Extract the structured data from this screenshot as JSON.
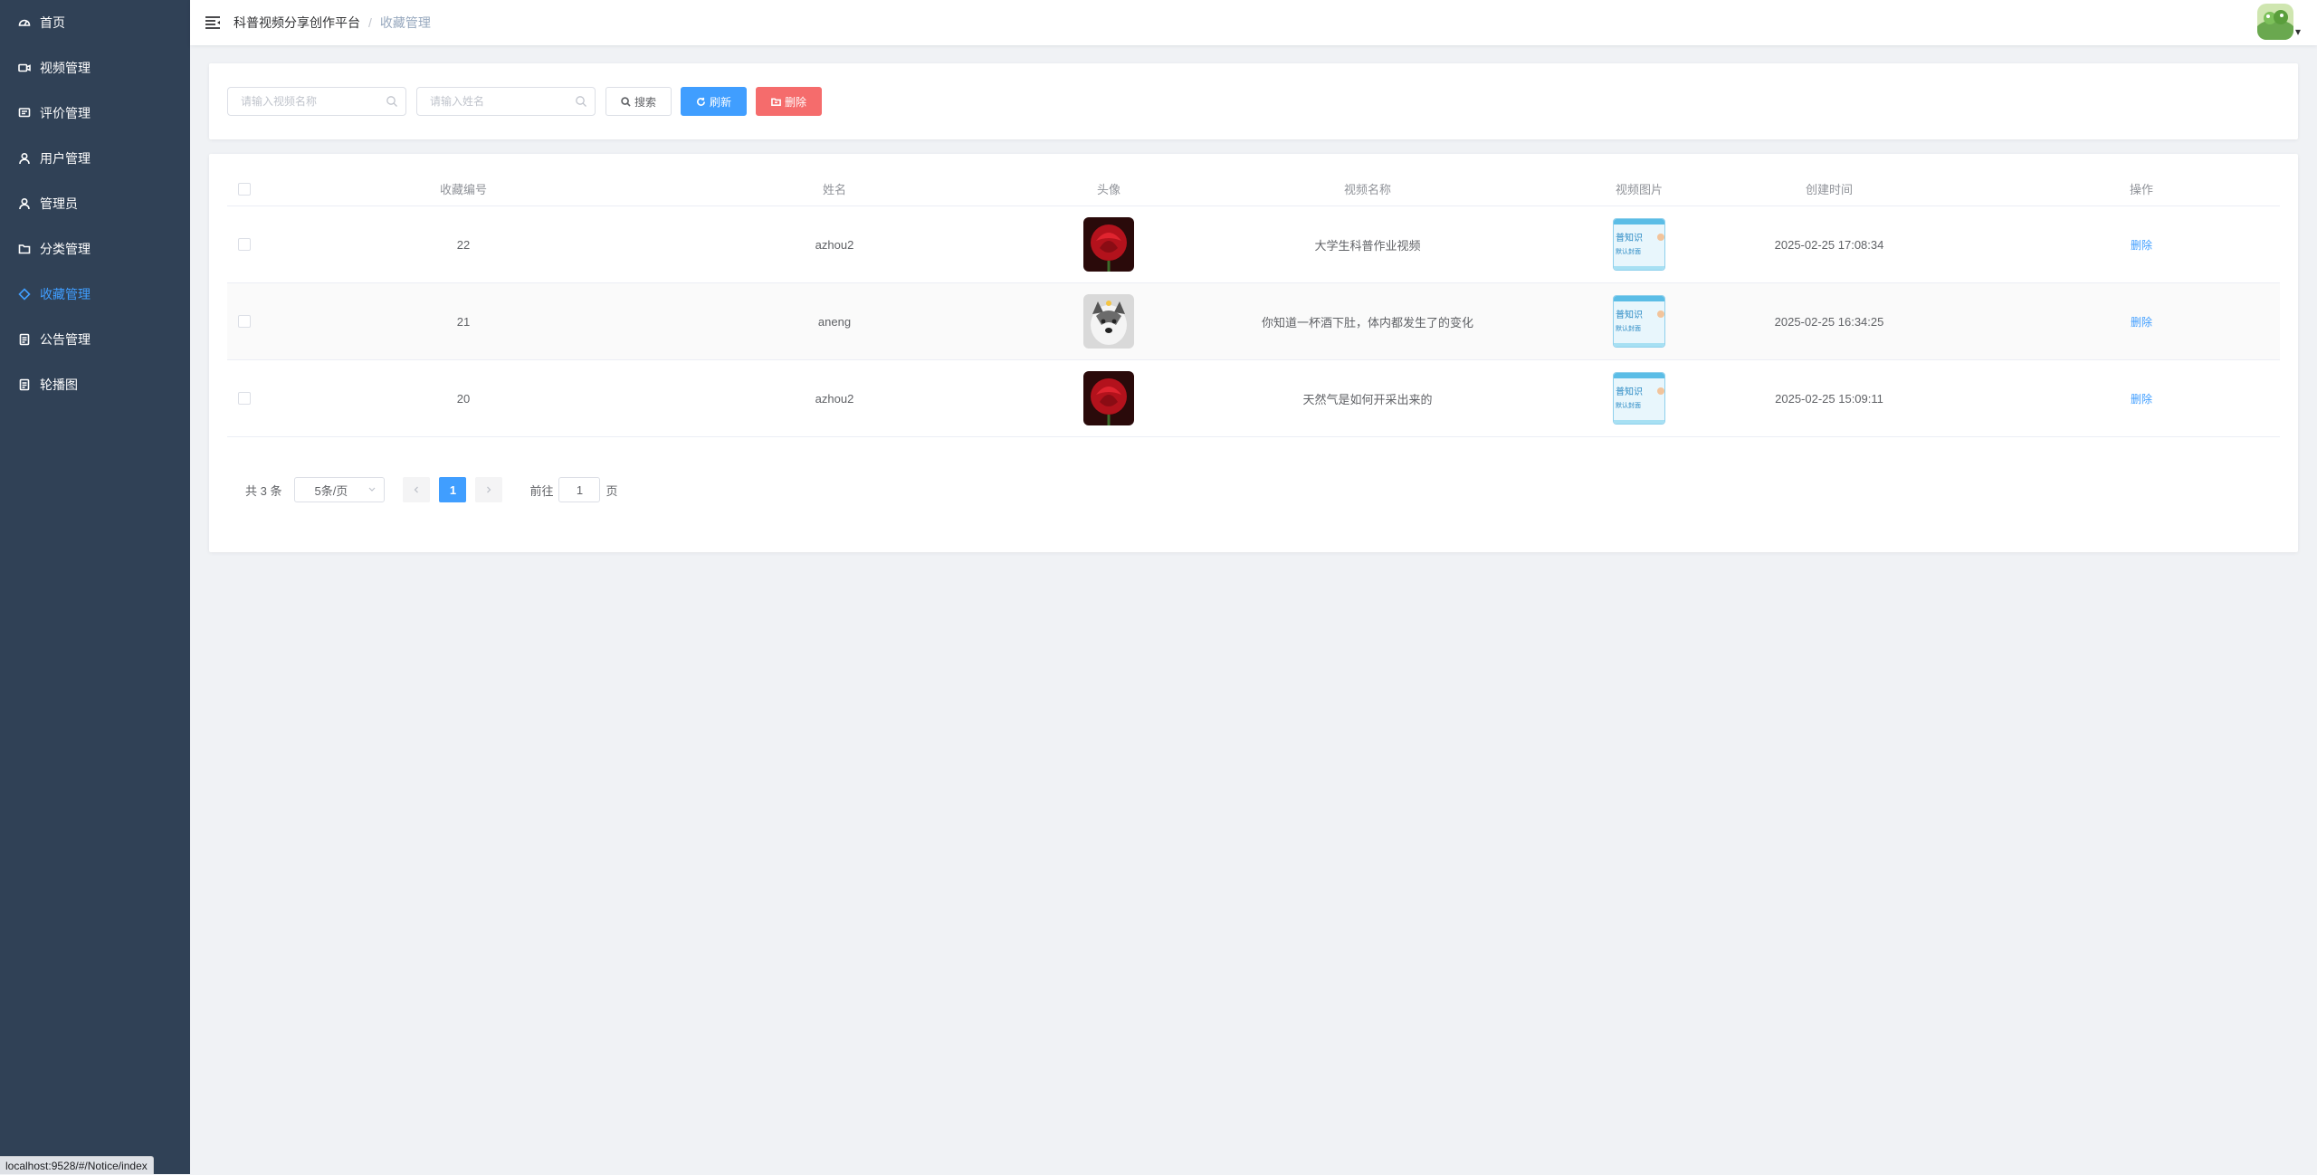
{
  "sidebar": {
    "items": [
      {
        "label": "首页",
        "icon": "dashboard-icon"
      },
      {
        "label": "视频管理",
        "icon": "video-camera-icon"
      },
      {
        "label": "评价管理",
        "icon": "comment-icon"
      },
      {
        "label": "用户管理",
        "icon": "user-icon"
      },
      {
        "label": "管理员",
        "icon": "admin-icon"
      },
      {
        "label": "分类管理",
        "icon": "folder-icon"
      },
      {
        "label": "收藏管理",
        "icon": "star-icon"
      },
      {
        "label": "公告管理",
        "icon": "document-icon"
      },
      {
        "label": "轮播图",
        "icon": "picture-icon"
      }
    ],
    "active_index": 6
  },
  "header": {
    "breadcrumb": [
      "科普视频分享创作平台",
      "收藏管理"
    ]
  },
  "search": {
    "video_placeholder": "请输入视频名称",
    "name_placeholder": "请输入姓名",
    "search_label": "搜索",
    "refresh_label": "刷新",
    "delete_label": "删除"
  },
  "table": {
    "columns": [
      "收藏编号",
      "姓名",
      "头像",
      "视频名称",
      "视频图片",
      "创建时间",
      "操作"
    ],
    "rows": [
      {
        "id": "22",
        "name": "azhou2",
        "avatar": "rose",
        "video_name": "大学生科普作业视频",
        "video_pic_text": [
          "普知识",
          "默认封面"
        ],
        "created": "2025-02-25 17:08:34",
        "action": "删除"
      },
      {
        "id": "21",
        "name": "aneng",
        "avatar": "dog",
        "video_name": "你知道一杯酒下肚，体内都发生了的变化",
        "video_pic_text": [
          "普知识",
          "默认封面"
        ],
        "created": "2025-02-25 16:34:25",
        "action": "删除"
      },
      {
        "id": "20",
        "name": "azhou2",
        "avatar": "rose",
        "video_name": "天然气是如何开采出来的",
        "video_pic_text": [
          "普知识",
          "默认封面"
        ],
        "created": "2025-02-25 15:09:11",
        "action": "删除"
      }
    ]
  },
  "pagination": {
    "total": "共 3 条",
    "page_size": "5条/页",
    "current_page": "1",
    "goto_prefix": "前往",
    "goto_value": "1",
    "goto_suffix": "页"
  },
  "status_bar": {
    "url": "localhost:9528/#/Notice/index"
  },
  "colors": {
    "sidebar_bg": "#304156",
    "primary": "#409eff",
    "danger": "#f56c6c"
  }
}
